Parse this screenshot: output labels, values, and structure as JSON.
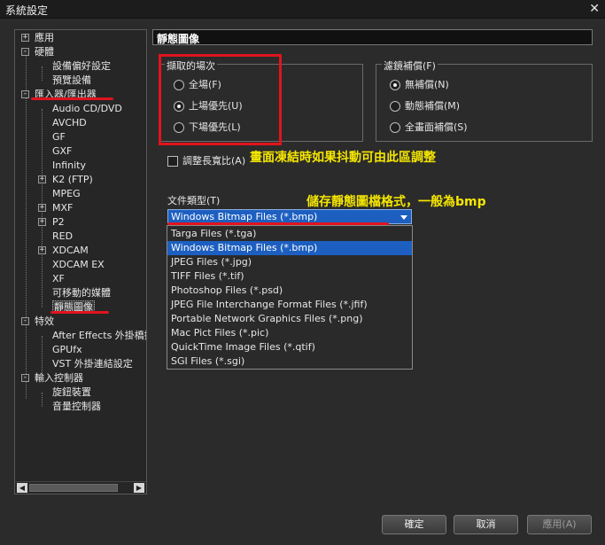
{
  "window": {
    "title": "系統設定"
  },
  "tree": {
    "items": [
      {
        "label": "應用",
        "expander": "+"
      },
      {
        "label": "硬體",
        "expander": "-"
      },
      {
        "label": "設備偏好設定"
      },
      {
        "label": "預覽設備"
      },
      {
        "label": "匯入器/匯出器",
        "expander": "-"
      },
      {
        "label": "Audio CD/DVD"
      },
      {
        "label": "AVCHD"
      },
      {
        "label": "GF"
      },
      {
        "label": "GXF"
      },
      {
        "label": "Infinity"
      },
      {
        "label": "K2 (FTP)",
        "expander": "+"
      },
      {
        "label": "MPEG"
      },
      {
        "label": "MXF",
        "expander": "+"
      },
      {
        "label": "P2",
        "expander": "+"
      },
      {
        "label": "RED"
      },
      {
        "label": "XDCAM",
        "expander": "+"
      },
      {
        "label": "XDCAM EX"
      },
      {
        "label": "XF"
      },
      {
        "label": "可移動的媒體"
      },
      {
        "label": "靜態圖像"
      },
      {
        "label": "特效",
        "expander": "-"
      },
      {
        "label": "After Effects 外掛橋接"
      },
      {
        "label": "GPUfx"
      },
      {
        "label": "VST 外掛連結設定"
      },
      {
        "label": "輸入控制器",
        "expander": "-"
      },
      {
        "label": "旋鈕裝置"
      },
      {
        "label": "音量控制器"
      }
    ]
  },
  "panel": {
    "title": "靜態圖像"
  },
  "capture_field": {
    "legend": "擷取的場次",
    "options": [
      "全場(F)",
      "上場優先(U)",
      "下場優先(L)"
    ],
    "selected_index": 1
  },
  "filter": {
    "legend": "濾鏡補償(F)",
    "options": [
      "無補償(N)",
      "動態補償(M)",
      "全畫面補償(S)"
    ],
    "selected_index": 0
  },
  "aspect_checkbox": {
    "label": "調整長寬比(A)",
    "checked": false
  },
  "file_type": {
    "label": "文件類型(T)",
    "selected": "Windows Bitmap Files (*.bmp)",
    "options": [
      "Targa Files (*.tga)",
      "Windows Bitmap Files (*.bmp)",
      "JPEG Files (*.jpg)",
      "TIFF Files (*.tif)",
      "Photoshop Files (*.psd)",
      "JPEG File Interchange Format Files (*.jfif)",
      "Portable Network Graphics Files (*.png)",
      "Mac Pict Files (*.pic)",
      "QuickTime Image Files (*.qtif)",
      "SGI Files (*.sgi)"
    ],
    "highlighted_index": 1
  },
  "annotations": {
    "freeze_note": "畫面凍結時如果抖動可由此區調整",
    "format_note": "儲存靜態圖檔格式，一般為bmp",
    "color": "#f5e600",
    "marker_color": "#e0141e"
  },
  "buttons": {
    "ok": "確定",
    "cancel": "取消",
    "apply": "應用(A)"
  }
}
